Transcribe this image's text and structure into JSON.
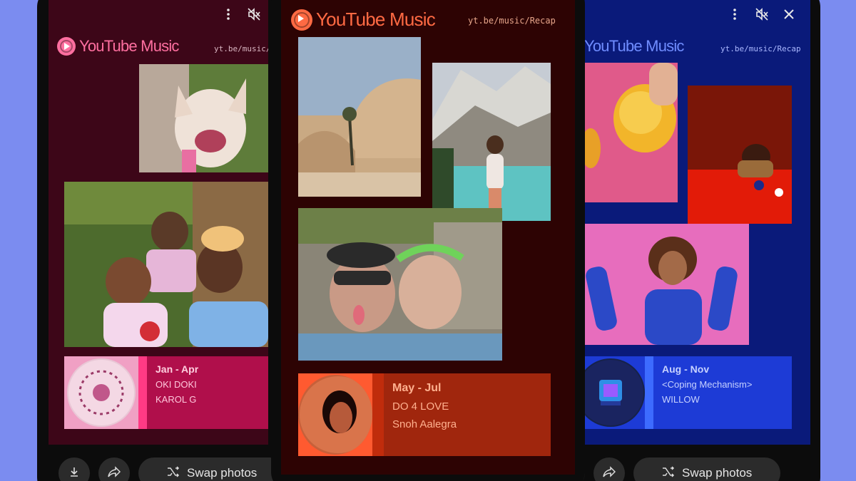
{
  "colors": {
    "background": "#7b8cf0",
    "left_screen": "#3d0618",
    "left_card": "#b00f4b",
    "middle_screen": "#2d0303",
    "middle_card": "#a0260d",
    "right_screen": "#0a1a7a",
    "right_card": "#2b4be3",
    "logo_left": "#ff6fa0",
    "logo_middle": "#ff6a43",
    "logo_right": "#6f8cff"
  },
  "app": {
    "logo_text": "YouTube Music",
    "url": "yt.be/music/Recap"
  },
  "left": {
    "range": "Jan - Apr",
    "title": "OKI DOKI",
    "artist": "KAROL G",
    "swap_label": "Swap photos",
    "icons": [
      "more-vert-icon",
      "mute-icon",
      "download-icon",
      "share-icon",
      "shuffle-icon"
    ]
  },
  "middle": {
    "range": "May - Jul",
    "title": "DO 4 LOVE",
    "artist": "Snoh Aalegra"
  },
  "right": {
    "range": "Aug - Nov",
    "title": "<Coping Mechanism>",
    "artist": "WILLOW",
    "swap_label": "Swap photos",
    "icons": [
      "more-vert-icon",
      "mute-icon",
      "close-icon",
      "share-icon",
      "shuffle-icon"
    ]
  }
}
